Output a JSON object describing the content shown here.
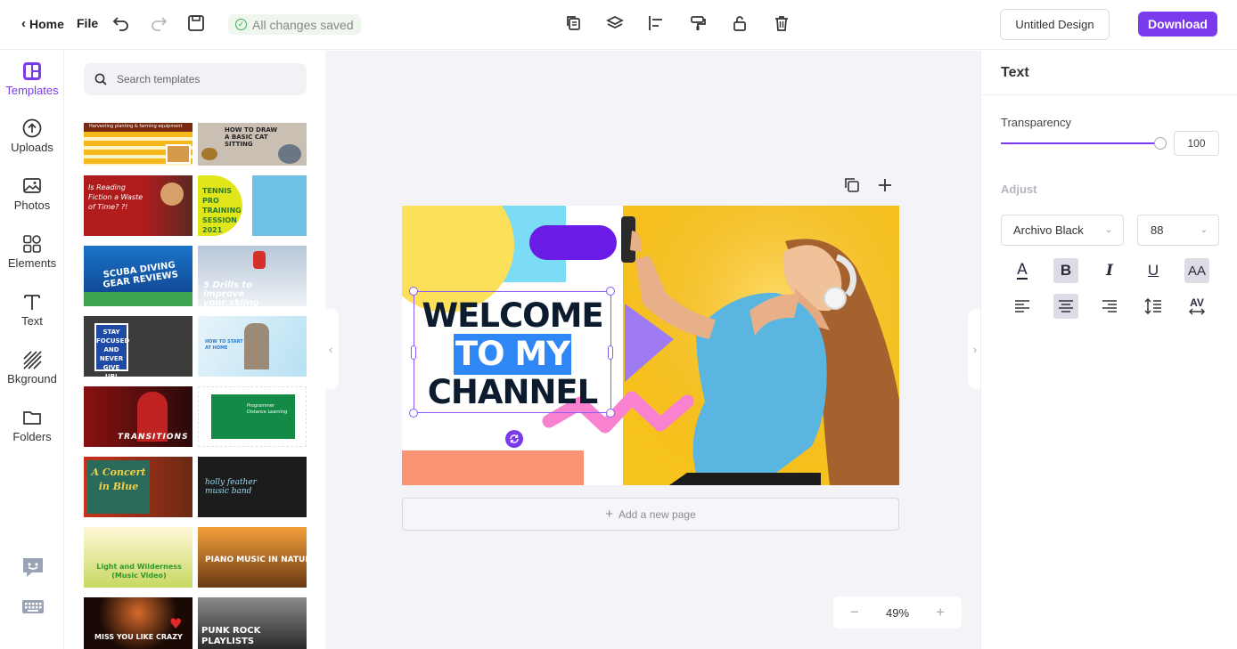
{
  "topbar": {
    "home_label": "Home",
    "file_label": "File",
    "save_status": "All changes saved",
    "design_name": "Untitled Design",
    "download_label": "Download"
  },
  "leftnav": {
    "items": [
      {
        "label": "Templates",
        "icon": "templates-icon",
        "active": true
      },
      {
        "label": "Uploads",
        "icon": "upload-icon"
      },
      {
        "label": "Photos",
        "icon": "photo-icon"
      },
      {
        "label": "Elements",
        "icon": "elements-icon"
      },
      {
        "label": "Text",
        "icon": "text-icon"
      },
      {
        "label": "Bkground",
        "icon": "background-icon"
      },
      {
        "label": "Folders",
        "icon": "folder-icon"
      }
    ]
  },
  "templates": {
    "search_placeholder": "Search templates",
    "items": [
      {
        "text": "Harvesting planting & farming equipment"
      },
      {
        "text": "HOW TO DRAW A BASIC CAT SITTING"
      },
      {
        "text": "Is Reading Fiction a Waste of Time? ?!"
      },
      {
        "text": "TENNIS PRO TRAINING SESSION 2021"
      },
      {
        "text": "SCUBA DIVING GEAR REVIEWS"
      },
      {
        "text": "5 Drills to improve your skiing"
      },
      {
        "text": "STAY FOCUSED AND NEVER GIVE UP!"
      },
      {
        "text": "HOW TO START AT HOME"
      },
      {
        "text": "TRANSITIONS"
      },
      {
        "text": "Programmer Distance Learning"
      },
      {
        "text": "A Concert in Blue"
      },
      {
        "text": "holly feather music band"
      },
      {
        "text": "Light and Wilderness (Music Video)"
      },
      {
        "text": "PIANO MUSIC IN NATURE"
      },
      {
        "text": "MISS YOU LIKE CRAZY"
      },
      {
        "text": "PUNK ROCK PLAYLISTS"
      }
    ]
  },
  "canvas": {
    "headline_line1": "WELCOME",
    "headline_line2": "TO MY",
    "headline_line3": "CHANNEL",
    "add_page_label": "Add a new page",
    "zoom": "49%",
    "colors": {
      "purple": "#6a1be6",
      "yellow": "#f7c31d",
      "cyan": "#7ddcf5",
      "pink": "#f882d0",
      "salmon": "#fa9274",
      "lavender": "#9e7bf2"
    }
  },
  "rightpanel": {
    "title": "Text",
    "transparency_label": "Transparency",
    "transparency_value": "100",
    "transparency_level": 100,
    "adjust_label": "Adjust",
    "font_family": "Archivo Black",
    "font_size": "88",
    "format_buttons": [
      {
        "icon": "text-color-icon",
        "glyph": "A"
      },
      {
        "icon": "bold-icon",
        "glyph": "B",
        "active": true
      },
      {
        "icon": "italic-icon",
        "glyph": "I"
      },
      {
        "icon": "underline-icon",
        "glyph": "U"
      },
      {
        "icon": "uppercase-icon",
        "glyph": "AA",
        "active": true
      }
    ],
    "align_buttons": [
      {
        "icon": "align-left-icon"
      },
      {
        "icon": "align-center-icon",
        "active": true
      },
      {
        "icon": "align-right-icon"
      },
      {
        "icon": "line-height-icon"
      },
      {
        "icon": "letter-spacing-icon",
        "glyph": "AV"
      }
    ]
  },
  "accent_color": "#7c3aed"
}
